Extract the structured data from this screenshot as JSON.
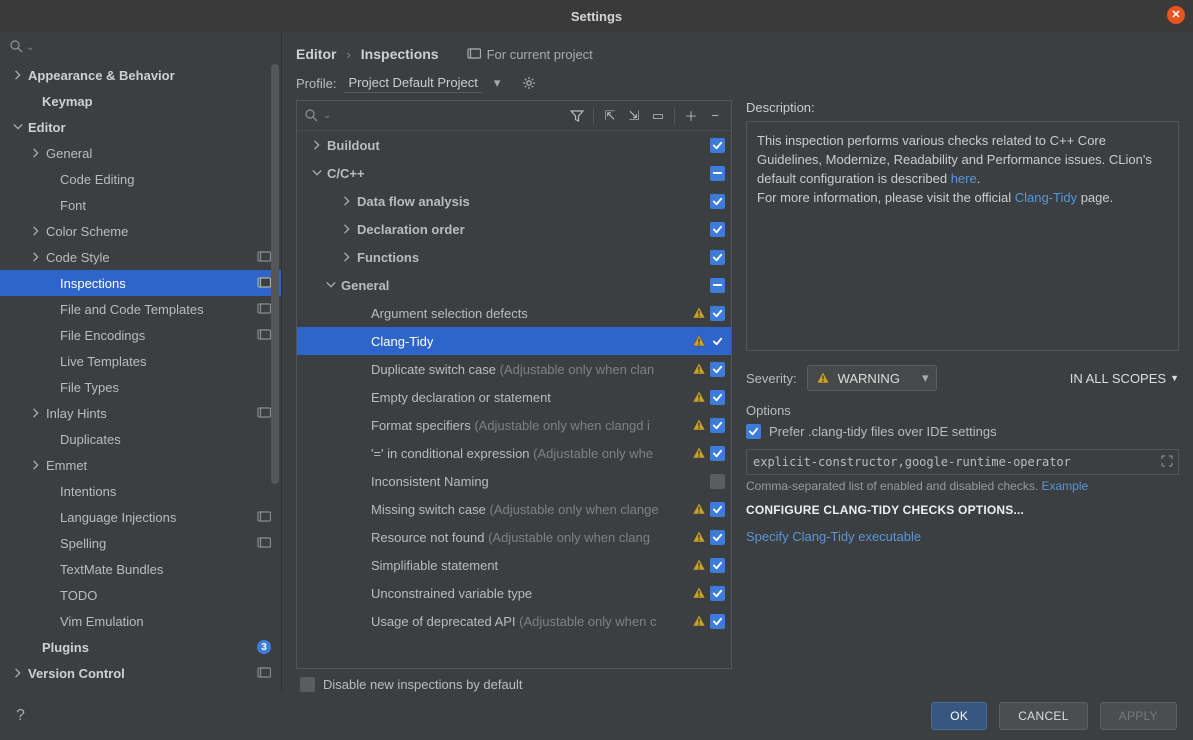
{
  "window": {
    "title": "Settings"
  },
  "breadcrumb": {
    "a": "Editor",
    "b": "Inspections",
    "for_project": "For current project"
  },
  "profile": {
    "label": "Profile:",
    "value": "Project Default  Project"
  },
  "sidebar": {
    "items": [
      {
        "label": "Appearance & Behavior",
        "indent": 12,
        "bold": true,
        "chev": "right"
      },
      {
        "label": "Keymap",
        "indent": 26,
        "bold": true
      },
      {
        "label": "Editor",
        "indent": 12,
        "bold": true,
        "chev": "down"
      },
      {
        "label": "General",
        "indent": 30,
        "chev": "right"
      },
      {
        "label": "Code Editing",
        "indent": 44
      },
      {
        "label": "Font",
        "indent": 44
      },
      {
        "label": "Color Scheme",
        "indent": 30,
        "chev": "right"
      },
      {
        "label": "Code Style",
        "indent": 30,
        "chev": "right",
        "proj": true
      },
      {
        "label": "Inspections",
        "indent": 44,
        "proj": true,
        "selected": true
      },
      {
        "label": "File and Code Templates",
        "indent": 44,
        "proj": true
      },
      {
        "label": "File Encodings",
        "indent": 44,
        "proj": true
      },
      {
        "label": "Live Templates",
        "indent": 44
      },
      {
        "label": "File Types",
        "indent": 44
      },
      {
        "label": "Inlay Hints",
        "indent": 30,
        "chev": "right",
        "proj": true
      },
      {
        "label": "Duplicates",
        "indent": 44
      },
      {
        "label": "Emmet",
        "indent": 30,
        "chev": "right"
      },
      {
        "label": "Intentions",
        "indent": 44
      },
      {
        "label": "Language Injections",
        "indent": 44,
        "proj": true
      },
      {
        "label": "Spelling",
        "indent": 44,
        "proj": true
      },
      {
        "label": "TextMate Bundles",
        "indent": 44
      },
      {
        "label": "TODO",
        "indent": 44
      },
      {
        "label": "Vim Emulation",
        "indent": 44
      },
      {
        "label": "Plugins",
        "indent": 26,
        "bold": true,
        "badge": "3"
      },
      {
        "label": "Version Control",
        "indent": 12,
        "bold": true,
        "chev": "right",
        "proj": true
      }
    ]
  },
  "tree": {
    "rows": [
      {
        "label": "Buildout",
        "indent": 6,
        "chev": "right",
        "bold": true,
        "state": "checked"
      },
      {
        "label": "C/C++",
        "indent": 6,
        "chev": "down",
        "bold": true,
        "state": "mixed"
      },
      {
        "label": "Data flow analysis",
        "indent": 36,
        "chev": "right",
        "bold": true,
        "state": "checked"
      },
      {
        "label": "Declaration order",
        "indent": 36,
        "chev": "right",
        "bold": true,
        "state": "checked"
      },
      {
        "label": "Functions",
        "indent": 36,
        "chev": "right",
        "bold": true,
        "state": "checked"
      },
      {
        "label": "General",
        "indent": 20,
        "chev": "down",
        "bold": true,
        "state": "mixed"
      },
      {
        "label": "Argument selection defects",
        "indent": 50,
        "state": "checked",
        "warn": true
      },
      {
        "label": "Clang-Tidy",
        "indent": 50,
        "state": "checked",
        "warn": true,
        "selected": true
      },
      {
        "label": "Duplicate switch case",
        "hint": " (Adjustable only when clan",
        "indent": 50,
        "state": "checked",
        "warn": true
      },
      {
        "label": "Empty declaration or statement",
        "indent": 50,
        "state": "checked",
        "warn": true
      },
      {
        "label": "Format specifiers",
        "hint": " (Adjustable only when clangd i",
        "indent": 50,
        "state": "checked",
        "warn": true
      },
      {
        "label": "'=' in conditional expression",
        "hint": " (Adjustable only whe",
        "indent": 50,
        "state": "checked",
        "warn": true
      },
      {
        "label": "Inconsistent Naming",
        "indent": 50,
        "state": "off"
      },
      {
        "label": "Missing switch case",
        "hint": " (Adjustable only when clange",
        "indent": 50,
        "state": "checked",
        "warn": true
      },
      {
        "label": "Resource not found",
        "hint": " (Adjustable only when clang",
        "indent": 50,
        "state": "checked",
        "warn": true
      },
      {
        "label": "Simplifiable statement",
        "indent": 50,
        "state": "checked",
        "warn": true
      },
      {
        "label": "Unconstrained variable type",
        "indent": 50,
        "state": "checked",
        "warn": true
      },
      {
        "label": "Usage of deprecated API",
        "hint": " (Adjustable only when c",
        "indent": 50,
        "state": "checked",
        "warn": true
      }
    ],
    "footer": "Disable new inspections by default"
  },
  "details": {
    "desc_label": "Description:",
    "desc_text_1": "This inspection performs various checks related to C++ Core Guidelines, Modernize, Readability and Performance issues. CLion's default configuration is described ",
    "desc_link_here": "here",
    "desc_text_1b": ".",
    "desc_text_2a": "For more information, please visit the official ",
    "desc_link_ct": "Clang-Tidy",
    "desc_text_2b": " page.",
    "severity_label": "Severity:",
    "severity_value": "WARNING",
    "scope_value": "IN ALL SCOPES",
    "options_label": "Options",
    "prefer_label": "Prefer .clang-tidy files over IDE settings",
    "checks_value": "explicit-constructor,google-runtime-operator",
    "checks_hint": "Comma-separated list of enabled and disabled checks. ",
    "checks_example": "Example",
    "configure_link": "CONFIGURE CLANG-TIDY CHECKS OPTIONS...",
    "exec_link": "Specify Clang-Tidy executable"
  },
  "buttons": {
    "ok": "OK",
    "cancel": "CANCEL",
    "apply": "APPLY"
  }
}
